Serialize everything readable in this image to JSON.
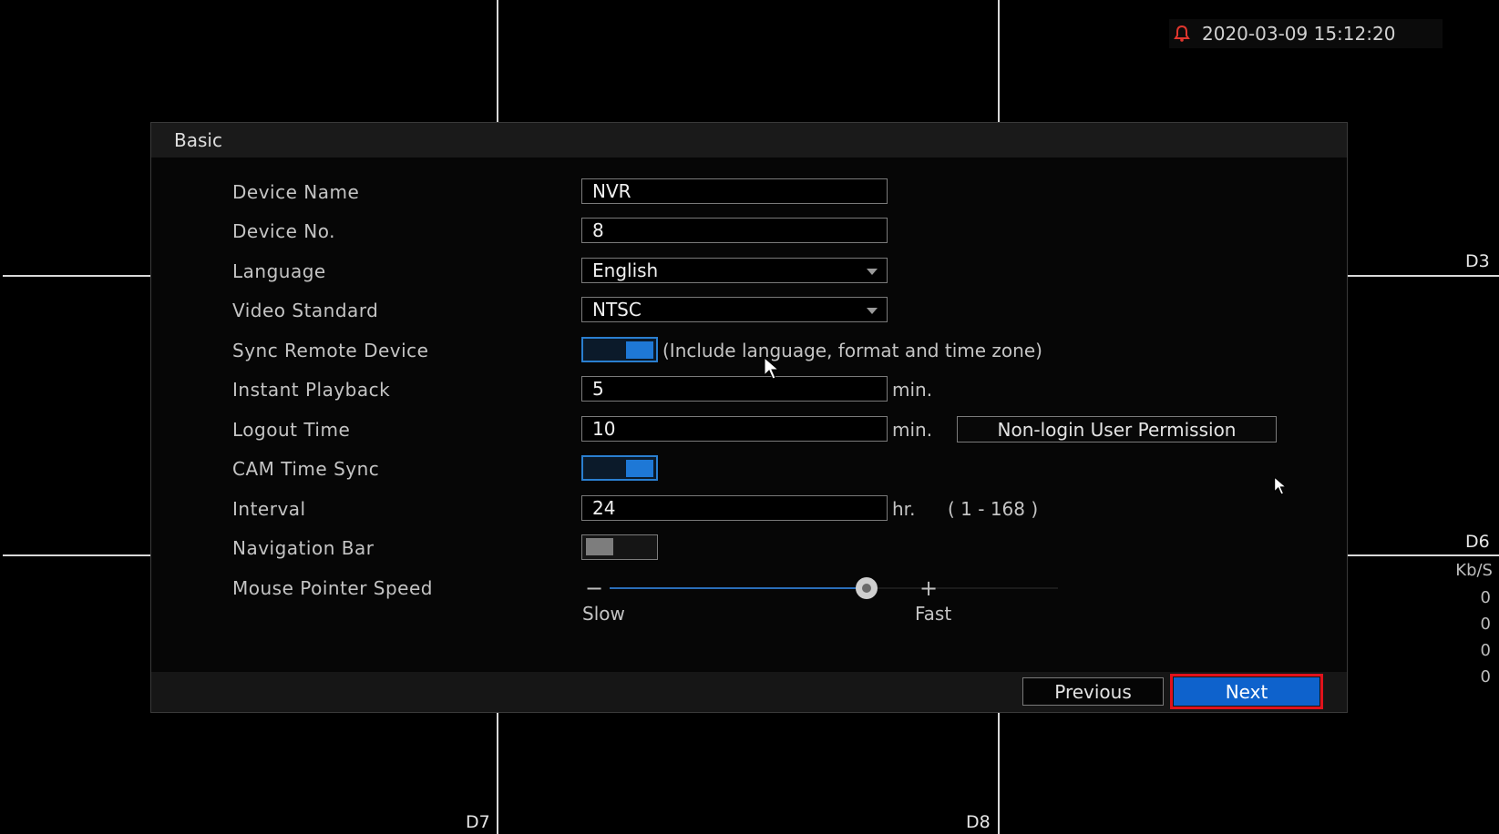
{
  "top_bar": {
    "datetime": "2020-03-09 15:12:20",
    "alarm_icon": "bell-icon",
    "alarm_color": "#e0362e"
  },
  "channels": {
    "d3": "D3",
    "d6": "D6",
    "d7": "D7",
    "d8": "D8"
  },
  "bitrate": {
    "unit": "Kb/S",
    "values": [
      "0",
      "0",
      "0",
      "0"
    ]
  },
  "dialog": {
    "title": "Basic",
    "fields": {
      "device_name": {
        "label": "Device Name",
        "value": "NVR"
      },
      "device_no": {
        "label": "Device No.",
        "value": "8"
      },
      "language": {
        "label": "Language",
        "value": "English"
      },
      "video_standard": {
        "label": "Video Standard",
        "value": "NTSC"
      },
      "sync_remote_device": {
        "label": "Sync Remote Device",
        "enabled": true,
        "hint": "(Include language, format and time zone)"
      },
      "instant_playback": {
        "label": "Instant Playback",
        "value": "5",
        "unit": "min."
      },
      "logout_time": {
        "label": "Logout Time",
        "value": "10",
        "unit": "min.",
        "button": "Non-login User Permission"
      },
      "cam_time_sync": {
        "label": "CAM Time Sync",
        "enabled": true
      },
      "interval": {
        "label": "Interval",
        "value": "24",
        "unit": "hr.",
        "range": "( 1 - 168 )"
      },
      "navigation_bar": {
        "label": "Navigation Bar",
        "enabled": false
      },
      "mouse_pointer_speed": {
        "label": "Mouse Pointer Speed",
        "slow_label": "Slow",
        "fast_label": "Fast",
        "minus": "−",
        "plus": "+",
        "level_fraction": 0.73
      }
    },
    "buttons": {
      "previous": "Previous",
      "next": "Next"
    }
  },
  "colors": {
    "accent": "#1e78d6",
    "highlight_border": "#e0121c"
  }
}
